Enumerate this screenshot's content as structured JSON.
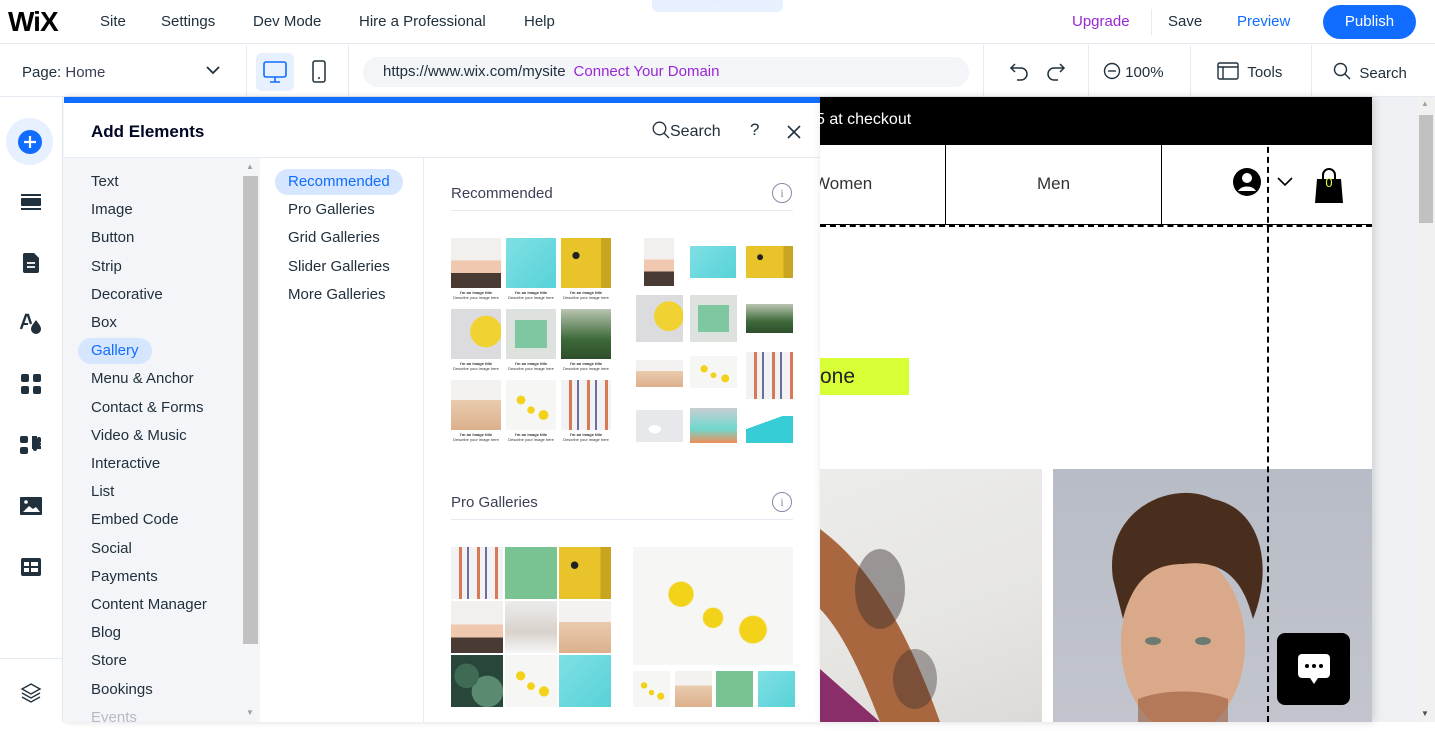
{
  "topbar": {
    "logo": "WiX",
    "menu": [
      "Site",
      "Settings",
      "Dev Mode",
      "Hire a Professional",
      "Help"
    ],
    "upgrade": "Upgrade",
    "save": "Save",
    "preview": "Preview",
    "publish": "Publish",
    "collapse_icon": "chevron-up-icon"
  },
  "toolbar": {
    "page_label": "Page:",
    "page_value": "Home",
    "url": "https://www.wix.com/mysite",
    "connect_domain": "Connect Your Domain",
    "zoom": "100%",
    "tools": "Tools",
    "search": "Search"
  },
  "rail": {
    "icons": [
      "add-elements-icon",
      "sections-icon",
      "pages-icon",
      "site-design-icon",
      "app-market-icon",
      "business-apps-icon",
      "media-icon",
      "cms-icon",
      "layers-icon"
    ]
  },
  "panel": {
    "title": "Add Elements",
    "search": "Search",
    "help": "?",
    "categories": [
      "Text",
      "Image",
      "Button",
      "Strip",
      "Decorative",
      "Box",
      "Gallery",
      "Menu & Anchor",
      "Contact & Forms",
      "Video & Music",
      "Interactive",
      "List",
      "Embed Code",
      "Social",
      "Payments",
      "Content Manager",
      "Blog",
      "Store",
      "Bookings",
      "Events"
    ],
    "selected_category": "Gallery",
    "subcategories": [
      "Recommended",
      "Pro Galleries",
      "Grid Galleries",
      "Slider Galleries",
      "More Galleries"
    ],
    "selected_subcategory": "Recommended",
    "sections": [
      {
        "title": "Recommended",
        "caption_title": "I'm an image title",
        "caption_desc": "Describe your image here"
      },
      {
        "title": "Pro Galleries"
      }
    ]
  },
  "site": {
    "promo_text": "5 at checkout",
    "nav": [
      "Women",
      "Men"
    ],
    "cart_count": "0",
    "hero_button": "one",
    "colors": {
      "accent": "#116dff",
      "upgrade": "#9a27d5",
      "hero_button": "#d8ff36"
    }
  }
}
